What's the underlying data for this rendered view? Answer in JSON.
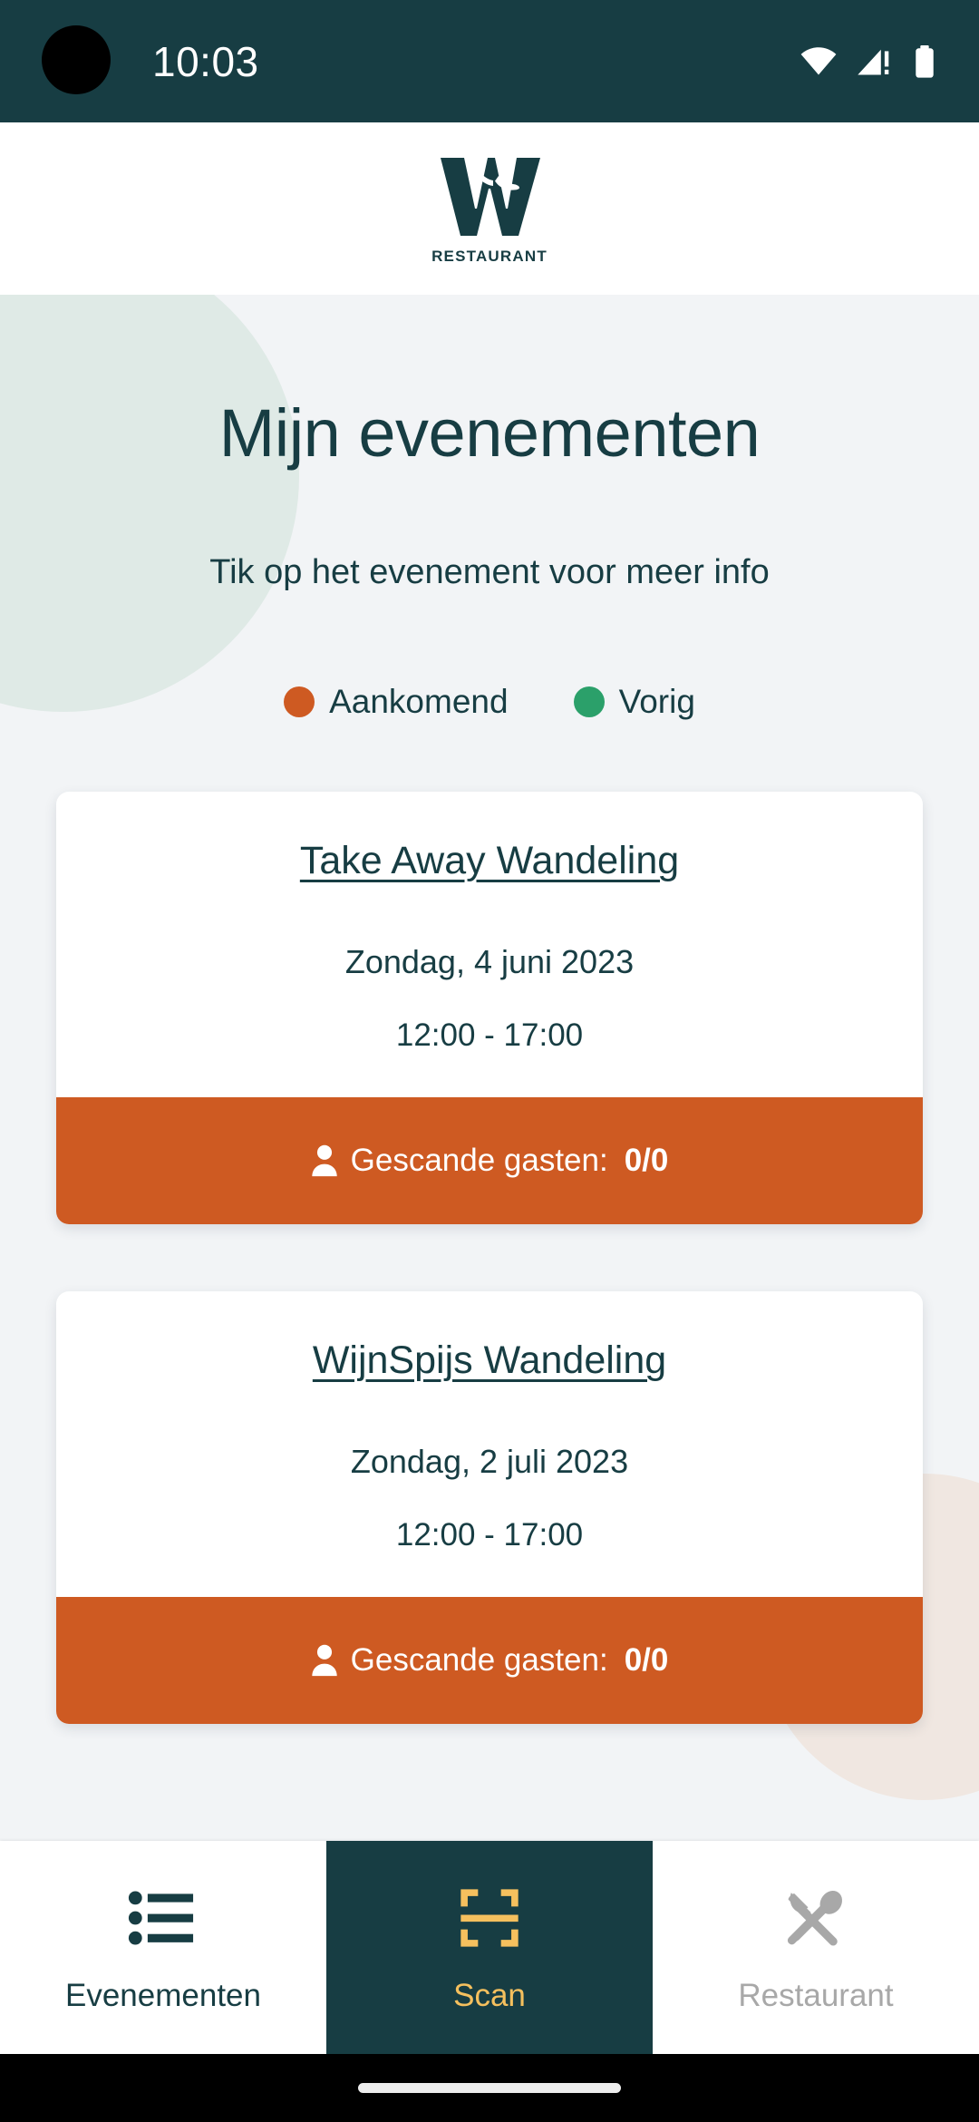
{
  "statusbar": {
    "time": "10:03",
    "icons": [
      "wifi-icon",
      "cellular-signal-warning-icon",
      "battery-icon"
    ]
  },
  "header": {
    "logo_letter": "W",
    "logo_subtitle": "RESTAURANT"
  },
  "page": {
    "title": "Mijn evenementen",
    "subtitle": "Tik op het evenement voor meer info"
  },
  "legend": {
    "items": [
      {
        "label": "Aankomend",
        "color": "#CE5A22"
      },
      {
        "label": "Vorig",
        "color": "#2BA06A"
      }
    ]
  },
  "events": [
    {
      "title": "Take Away Wandeling",
      "date": "Zondag, 4 juni 2023",
      "time": "12:00 - 17:00",
      "status": "Aankomend",
      "footer_label": "Gescande gasten:",
      "footer_count": "0/0"
    },
    {
      "title": "WijnSpijs Wandeling",
      "date": "Zondag, 2 juli 2023",
      "time": "12:00 - 17:00",
      "status": "Aankomend",
      "footer_label": "Gescande gasten:",
      "footer_count": "0/0"
    }
  ],
  "bottomnav": {
    "items": [
      {
        "label": "Evenementen",
        "icon": "list-icon",
        "active": false
      },
      {
        "label": "Scan",
        "icon": "qr-scan-icon",
        "active": true
      },
      {
        "label": "Restaurant",
        "icon": "fork-spoon-icon",
        "active": false
      }
    ]
  },
  "colors": {
    "brand_teal": "#173D43",
    "accent_orange": "#CE5A22",
    "accent_green": "#2BA06A",
    "accent_amber": "#F5C05E",
    "background": "#F2F4F6",
    "disabled_gray": "#A8A8A8"
  }
}
